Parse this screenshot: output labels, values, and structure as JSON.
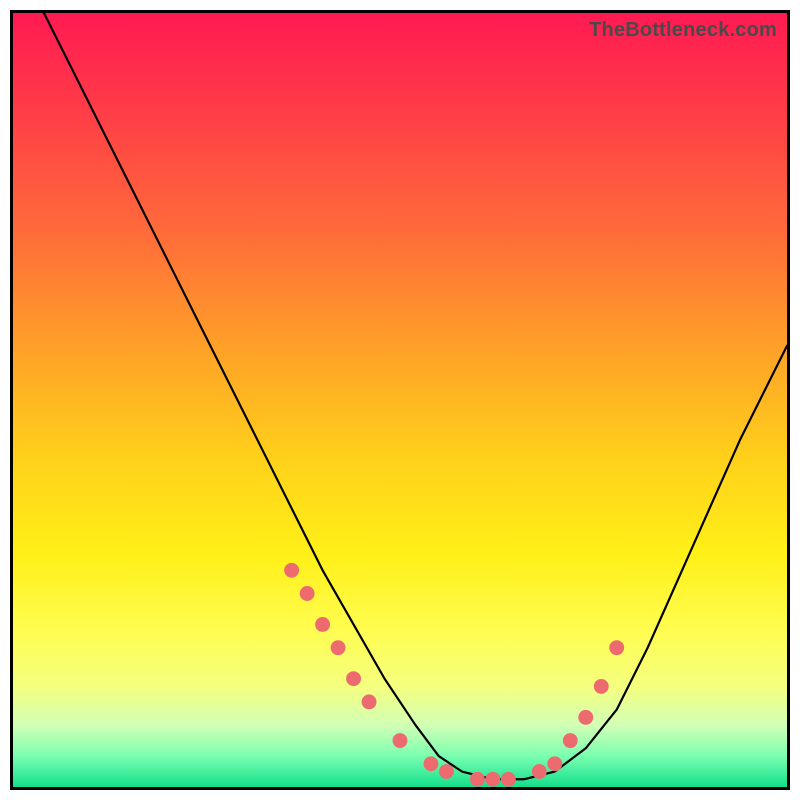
{
  "watermark": "TheBottleneck.com",
  "chart_data": {
    "type": "line",
    "title": "",
    "xlabel": "",
    "ylabel": "",
    "xlim": [
      0,
      100
    ],
    "ylim": [
      0,
      100
    ],
    "series": [
      {
        "name": "curve",
        "x": [
          4,
          8,
          12,
          16,
          20,
          24,
          28,
          32,
          36,
          40,
          44,
          48,
          52,
          55,
          58,
          62,
          66,
          70,
          74,
          78,
          82,
          86,
          90,
          94,
          98,
          100
        ],
        "y": [
          100,
          92,
          84,
          76,
          68,
          60,
          52,
          44,
          36,
          28,
          21,
          14,
          8,
          4,
          2,
          1,
          1,
          2,
          5,
          10,
          18,
          27,
          36,
          45,
          53,
          57
        ]
      }
    ],
    "markers": {
      "name": "highlight-dots",
      "color": "#ed6a6f",
      "x": [
        36,
        38,
        40,
        42,
        44,
        46,
        50,
        54,
        56,
        60,
        62,
        64,
        68,
        70,
        72,
        74,
        76,
        78
      ],
      "y": [
        28,
        25,
        21,
        18,
        14,
        11,
        6,
        3,
        2,
        1,
        1,
        1,
        2,
        3,
        6,
        9,
        13,
        18
      ]
    }
  }
}
